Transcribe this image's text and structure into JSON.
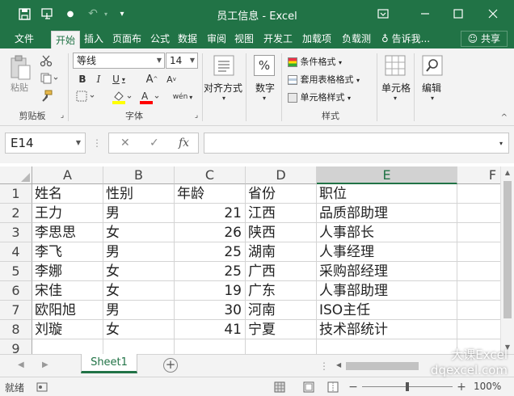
{
  "window": {
    "title": "员工信息 - Excel"
  },
  "tabs": [
    {
      "label": "文件"
    },
    {
      "label": "开始"
    },
    {
      "label": "插入"
    },
    {
      "label": "页面布"
    },
    {
      "label": "公式"
    },
    {
      "label": "数据"
    },
    {
      "label": "审阅"
    },
    {
      "label": "视图"
    },
    {
      "label": "开发工"
    },
    {
      "label": "加载项"
    },
    {
      "label": "负载测"
    }
  ],
  "tell_me": "告诉我...",
  "share_label": "共享",
  "ribbon": {
    "clipboard": {
      "paste": "粘贴",
      "label": "剪贴板"
    },
    "font": {
      "name": "等线",
      "size": "14",
      "label": "字体"
    },
    "alignment": {
      "label": "对齐方式"
    },
    "number": {
      "label": "数字"
    },
    "styles": {
      "conditional": "条件格式",
      "table": "套用表格格式",
      "cell": "单元格样式",
      "label": "样式"
    },
    "cells": {
      "label": "单元格"
    },
    "editing": {
      "label": "编辑"
    }
  },
  "name_box": "E14",
  "columns": [
    "A",
    "B",
    "C",
    "D",
    "E",
    "F"
  ],
  "rows": [
    {
      "num": "1",
      "a": "姓名",
      "b": "性别",
      "c": "年龄",
      "d": "省份",
      "e": "职位"
    },
    {
      "num": "2",
      "a": "王力",
      "b": "男",
      "c": "21",
      "d": "江西",
      "e": "品质部助理"
    },
    {
      "num": "3",
      "a": "李思思",
      "b": "女",
      "c": "26",
      "d": "陕西",
      "e": "人事部长"
    },
    {
      "num": "4",
      "a": "李飞",
      "b": "男",
      "c": "25",
      "d": "湖南",
      "e": "人事经理"
    },
    {
      "num": "5",
      "a": "李娜",
      "b": "女",
      "c": "25",
      "d": "广西",
      "e": "采购部经理"
    },
    {
      "num": "6",
      "a": "宋佳",
      "b": "女",
      "c": "19",
      "d": "广东",
      "e": "人事部助理"
    },
    {
      "num": "7",
      "a": "欧阳旭",
      "b": "男",
      "c": "30",
      "d": "河南",
      "e": "ISO主任"
    },
    {
      "num": "8",
      "a": "刘璇",
      "b": "女",
      "c": "41",
      "d": "宁夏",
      "e": "技术部统计"
    },
    {
      "num": "9",
      "a": "",
      "b": "",
      "c": "",
      "d": "",
      "e": ""
    }
  ],
  "sheet_tab": "Sheet1",
  "status_text": "就绪",
  "watermark": {
    "line1": "大课Excel",
    "line2": "dqexcel.com"
  },
  "zoom": "100%",
  "colors": {
    "accent": "#217346"
  }
}
